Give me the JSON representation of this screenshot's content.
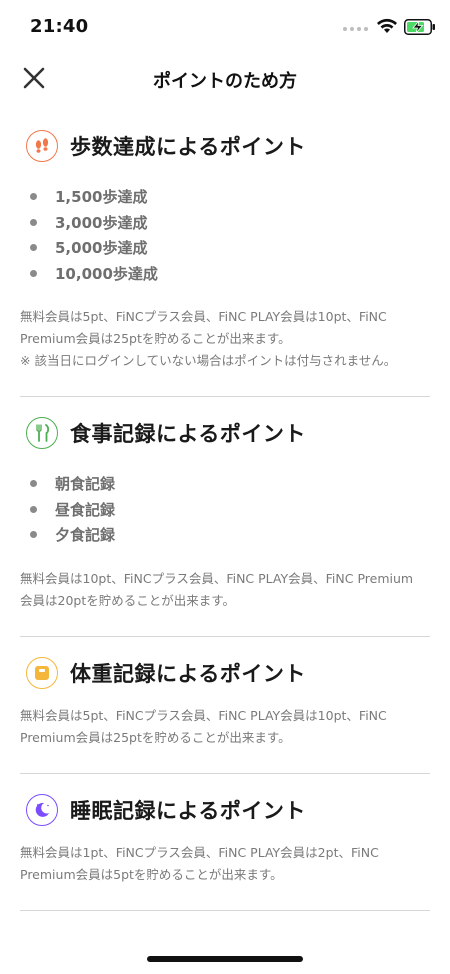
{
  "status_bar": {
    "time": "21:40"
  },
  "nav": {
    "title": "ポイントのため方",
    "close_icon": "close-icon"
  },
  "sections": [
    {
      "icon": "footprints-icon",
      "icon_color": "#f0784b",
      "title": "歩数達成によるポイント",
      "items": [
        "1,500歩達成",
        "3,000歩達成",
        "5,000歩達成",
        "10,000歩達成"
      ],
      "note": "無料会員は5pt、FiNCプラス会員、FiNC PLAY会員は10pt、FiNC Premium会員は25ptを貯めることが出来ます。",
      "note2": "※ 該当日にログインしていない場合はポイントは付与されません。"
    },
    {
      "icon": "fork-knife-icon",
      "icon_color": "#4caf50",
      "title": "食事記録によるポイント",
      "items": [
        "朝食記録",
        "昼食記録",
        "夕食記録"
      ],
      "note": "無料会員は10pt、FiNCプラス会員、FiNC PLAY会員、FiNC Premium会員は20ptを貯めることが出来ます。"
    },
    {
      "icon": "scale-icon",
      "icon_color": "#f5b73b",
      "title": "体重記録によるポイント",
      "note": "無料会員は5pt、FiNCプラス会員、FiNC PLAY会員は10pt、FiNC Premium会員は25ptを貯めることが出来ます。"
    },
    {
      "icon": "moon-icon",
      "icon_color": "#7c4dff",
      "title": "睡眠記録によるポイント",
      "note": "無料会員は1pt、FiNCプラス会員、FiNC PLAY会員は2pt、FiNC Premium会員は5ptを貯めることが出来ます。"
    }
  ]
}
